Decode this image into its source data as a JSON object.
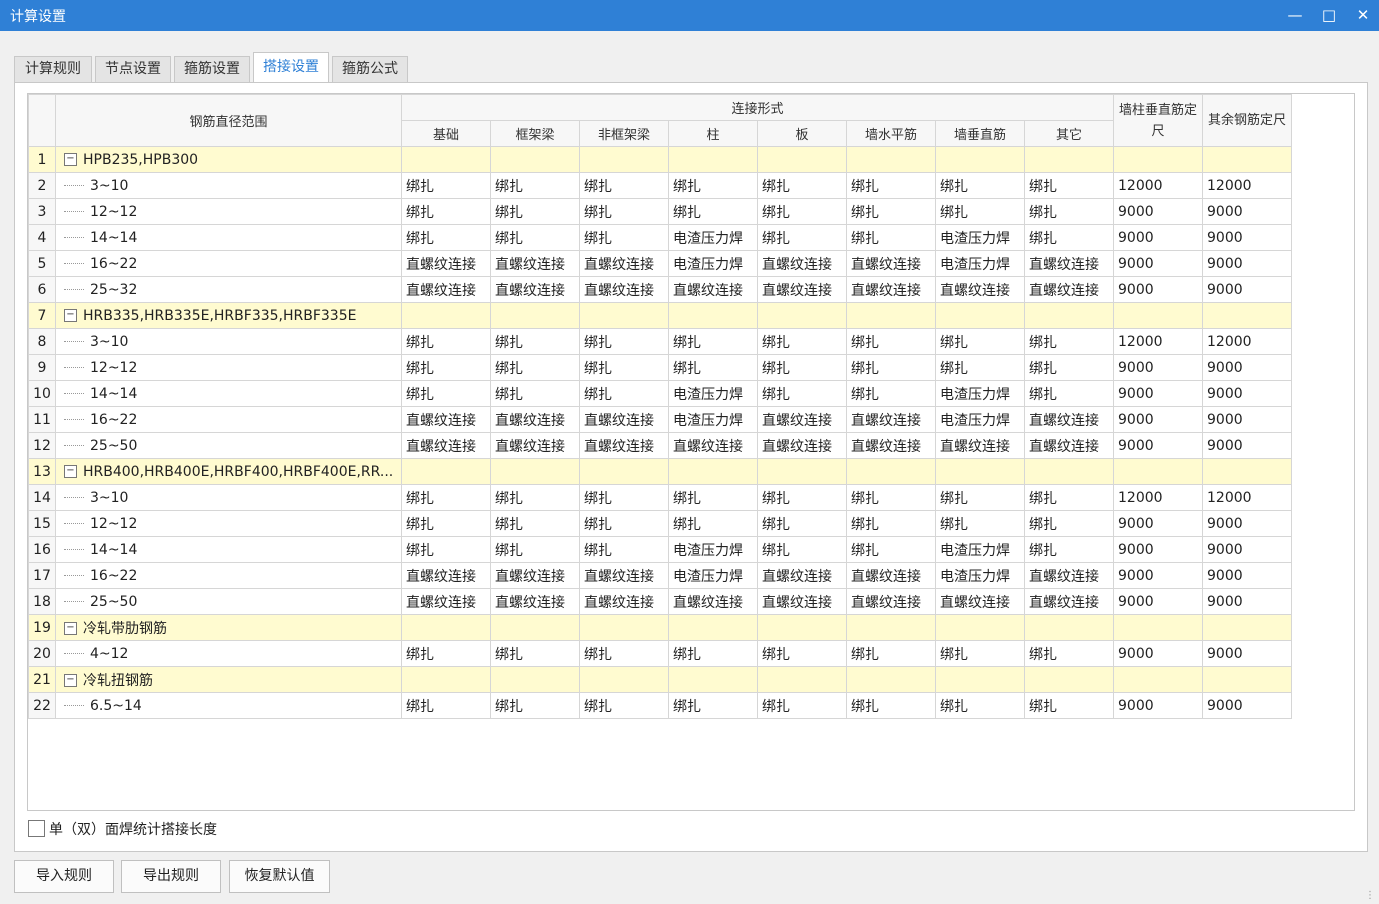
{
  "window": {
    "title": "计算设置",
    "minimize_icon": "minimize-icon",
    "maximize_icon": "maximize-icon",
    "close_icon": "close-icon"
  },
  "tabs": [
    {
      "label": "计算规则",
      "active": false
    },
    {
      "label": "节点设置",
      "active": false
    },
    {
      "label": "箍筋设置",
      "active": false
    },
    {
      "label": "搭接设置",
      "active": true
    },
    {
      "label": "箍筋公式",
      "active": false
    }
  ],
  "grid": {
    "header": {
      "range": "钢筋直径范围",
      "connection_group": "连接形式",
      "columns": [
        "基础",
        "框架梁",
        "非框架梁",
        "柱",
        "板",
        "墙水平筋",
        "墙垂直筋",
        "其它"
      ],
      "wall_col_len": "墙柱垂直筋定尺",
      "other_len": "其余钢筋定尺"
    },
    "rows": [
      {
        "no": "1",
        "type": "group",
        "label": "HPB235,HPB300"
      },
      {
        "no": "2",
        "type": "item",
        "label": "3~10",
        "cells": [
          "绑扎",
          "绑扎",
          "绑扎",
          "绑扎",
          "绑扎",
          "绑扎",
          "绑扎",
          "绑扎",
          "12000",
          "12000"
        ]
      },
      {
        "no": "3",
        "type": "item",
        "label": "12~12",
        "cells": [
          "绑扎",
          "绑扎",
          "绑扎",
          "绑扎",
          "绑扎",
          "绑扎",
          "绑扎",
          "绑扎",
          "9000",
          "9000"
        ]
      },
      {
        "no": "4",
        "type": "item",
        "label": "14~14",
        "cells": [
          "绑扎",
          "绑扎",
          "绑扎",
          "电渣压力焊",
          "绑扎",
          "绑扎",
          "电渣压力焊",
          "绑扎",
          "9000",
          "9000"
        ]
      },
      {
        "no": "5",
        "type": "item",
        "label": "16~22",
        "cells": [
          "直螺纹连接",
          "直螺纹连接",
          "直螺纹连接",
          "电渣压力焊",
          "直螺纹连接",
          "直螺纹连接",
          "电渣压力焊",
          "直螺纹连接",
          "9000",
          "9000"
        ]
      },
      {
        "no": "6",
        "type": "item",
        "label": "25~32",
        "cells": [
          "直螺纹连接",
          "直螺纹连接",
          "直螺纹连接",
          "直螺纹连接",
          "直螺纹连接",
          "直螺纹连接",
          "直螺纹连接",
          "直螺纹连接",
          "9000",
          "9000"
        ]
      },
      {
        "no": "7",
        "type": "group",
        "label": "HRB335,HRB335E,HRBF335,HRBF335E"
      },
      {
        "no": "8",
        "type": "item",
        "label": "3~10",
        "cells": [
          "绑扎",
          "绑扎",
          "绑扎",
          "绑扎",
          "绑扎",
          "绑扎",
          "绑扎",
          "绑扎",
          "12000",
          "12000"
        ]
      },
      {
        "no": "9",
        "type": "item",
        "label": "12~12",
        "cells": [
          "绑扎",
          "绑扎",
          "绑扎",
          "绑扎",
          "绑扎",
          "绑扎",
          "绑扎",
          "绑扎",
          "9000",
          "9000"
        ]
      },
      {
        "no": "10",
        "type": "item",
        "label": "14~14",
        "cells": [
          "绑扎",
          "绑扎",
          "绑扎",
          "电渣压力焊",
          "绑扎",
          "绑扎",
          "电渣压力焊",
          "绑扎",
          "9000",
          "9000"
        ]
      },
      {
        "no": "11",
        "type": "item",
        "label": "16~22",
        "cells": [
          "直螺纹连接",
          "直螺纹连接",
          "直螺纹连接",
          "电渣压力焊",
          "直螺纹连接",
          "直螺纹连接",
          "电渣压力焊",
          "直螺纹连接",
          "9000",
          "9000"
        ]
      },
      {
        "no": "12",
        "type": "item",
        "label": "25~50",
        "cells": [
          "直螺纹连接",
          "直螺纹连接",
          "直螺纹连接",
          "直螺纹连接",
          "直螺纹连接",
          "直螺纹连接",
          "直螺纹连接",
          "直螺纹连接",
          "9000",
          "9000"
        ]
      },
      {
        "no": "13",
        "type": "group",
        "label": "HRB400,HRB400E,HRBF400,HRBF400E,RR..."
      },
      {
        "no": "14",
        "type": "item",
        "label": "3~10",
        "cells": [
          "绑扎",
          "绑扎",
          "绑扎",
          "绑扎",
          "绑扎",
          "绑扎",
          "绑扎",
          "绑扎",
          "12000",
          "12000"
        ]
      },
      {
        "no": "15",
        "type": "item",
        "label": "12~12",
        "cells": [
          "绑扎",
          "绑扎",
          "绑扎",
          "绑扎",
          "绑扎",
          "绑扎",
          "绑扎",
          "绑扎",
          "9000",
          "9000"
        ]
      },
      {
        "no": "16",
        "type": "item",
        "label": "14~14",
        "cells": [
          "绑扎",
          "绑扎",
          "绑扎",
          "电渣压力焊",
          "绑扎",
          "绑扎",
          "电渣压力焊",
          "绑扎",
          "9000",
          "9000"
        ]
      },
      {
        "no": "17",
        "type": "item",
        "label": "16~22",
        "cells": [
          "直螺纹连接",
          "直螺纹连接",
          "直螺纹连接",
          "电渣压力焊",
          "直螺纹连接",
          "直螺纹连接",
          "电渣压力焊",
          "直螺纹连接",
          "9000",
          "9000"
        ]
      },
      {
        "no": "18",
        "type": "item",
        "label": "25~50",
        "cells": [
          "直螺纹连接",
          "直螺纹连接",
          "直螺纹连接",
          "直螺纹连接",
          "直螺纹连接",
          "直螺纹连接",
          "直螺纹连接",
          "直螺纹连接",
          "9000",
          "9000"
        ]
      },
      {
        "no": "19",
        "type": "group",
        "label": "冷轧带肋钢筋"
      },
      {
        "no": "20",
        "type": "item",
        "label": "4~12",
        "cells": [
          "绑扎",
          "绑扎",
          "绑扎",
          "绑扎",
          "绑扎",
          "绑扎",
          "绑扎",
          "绑扎",
          "9000",
          "9000"
        ]
      },
      {
        "no": "21",
        "type": "group",
        "label": "冷轧扭钢筋"
      },
      {
        "no": "22",
        "type": "item",
        "label": "6.5~14",
        "cells": [
          "绑扎",
          "绑扎",
          "绑扎",
          "绑扎",
          "绑扎",
          "绑扎",
          "绑扎",
          "绑扎",
          "9000",
          "9000"
        ]
      }
    ]
  },
  "checkbox": {
    "label": "单（双）面焊统计搭接长度",
    "checked": false
  },
  "buttons": {
    "import": "导入规则",
    "export": "导出规则",
    "restore": "恢复默认值"
  }
}
